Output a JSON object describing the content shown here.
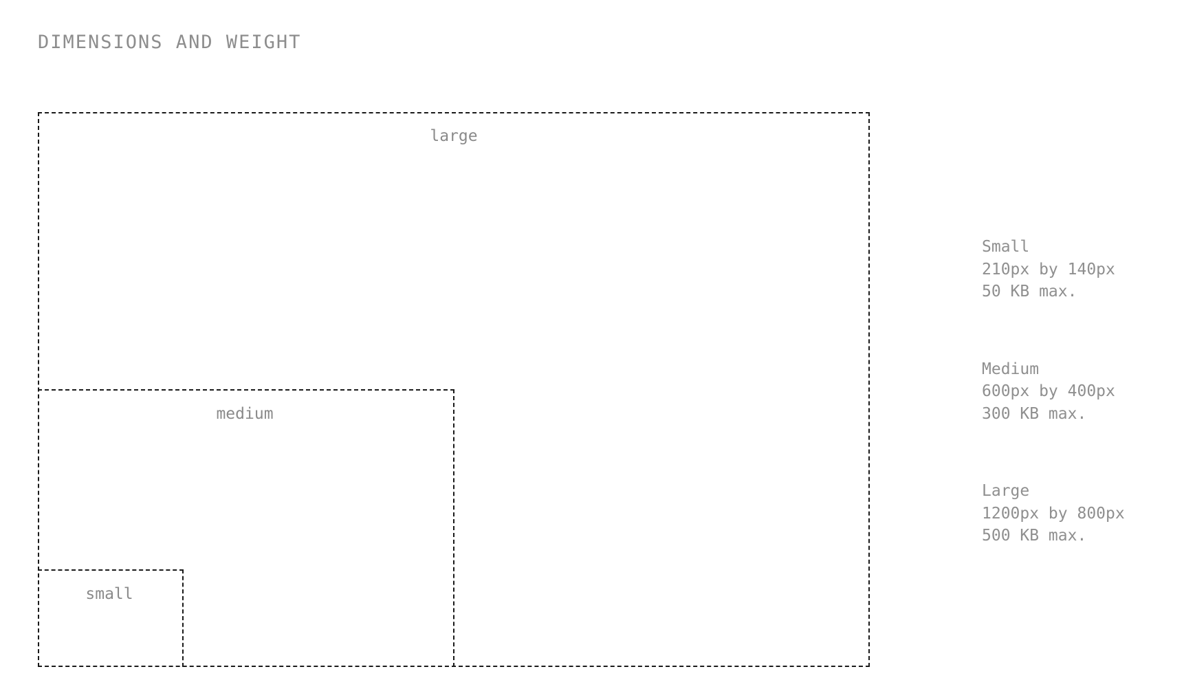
{
  "title": "DIMENSIONS AND WEIGHT",
  "boxes": {
    "large": "large",
    "medium": "medium",
    "small": "small"
  },
  "specs": [
    {
      "name": "Small",
      "dimensions": "210px by 140px",
      "weight": "50 KB max."
    },
    {
      "name": "Medium",
      "dimensions": "600px by 400px",
      "weight": "300 KB max."
    },
    {
      "name": "Large",
      "dimensions": "1200px by 800px",
      "weight": "500 KB max."
    }
  ],
  "colors": {
    "text": "#8a8a8a",
    "border": "#1a1a1a",
    "background": "#ffffff"
  }
}
